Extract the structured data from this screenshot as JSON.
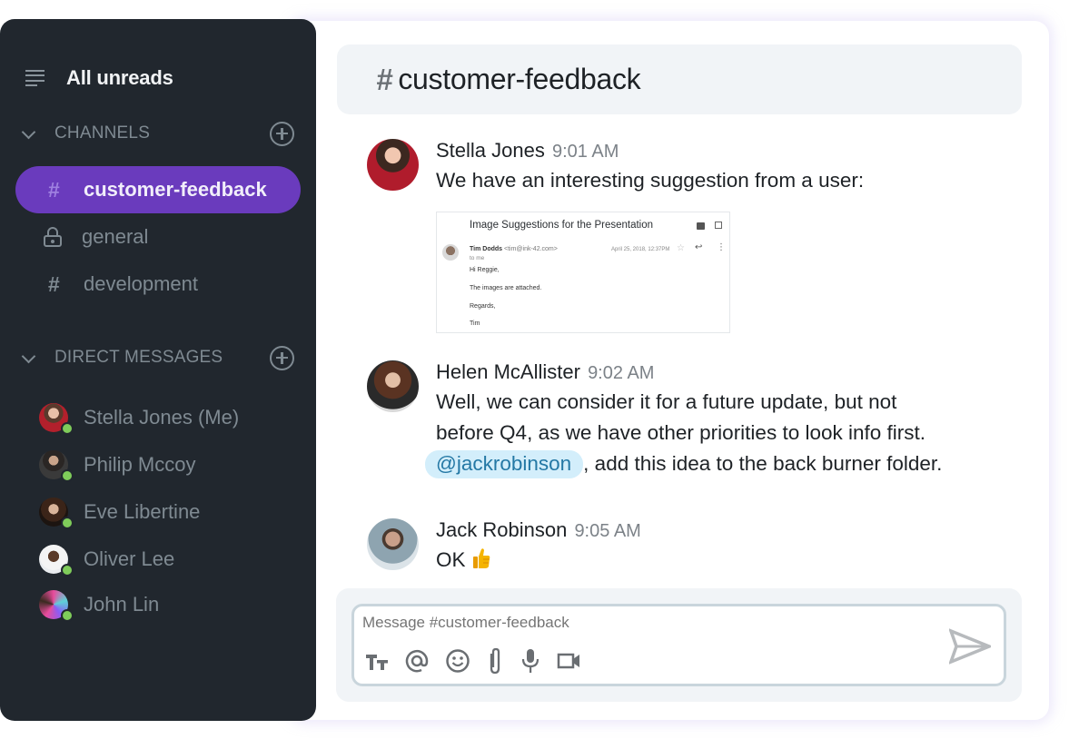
{
  "sidebar": {
    "all_unreads": {
      "label": "All unreads",
      "icon": "list-icon"
    },
    "channels_section": {
      "title": "CHANNELS",
      "add_icon": "add-circle-icon"
    },
    "channels": [
      {
        "name": "customer-feedback",
        "icon": "hash-icon",
        "active": true
      },
      {
        "name": "general",
        "icon": "lock-icon",
        "active": false
      },
      {
        "name": "development",
        "icon": "hash-icon",
        "active": false
      }
    ],
    "dm_section": {
      "title": "DIRECT MESSAGES",
      "add_icon": "add-circle-icon"
    },
    "direct_messages": [
      {
        "name": "Stella Jones (Me)",
        "status": "online"
      },
      {
        "name": "Philip Mccoy",
        "status": "online"
      },
      {
        "name": "Eve Libertine",
        "status": "online"
      },
      {
        "name": "Oliver Lee",
        "status": "online"
      },
      {
        "name": "John Lin",
        "status": "online"
      }
    ]
  },
  "channel_header": {
    "hash": "#",
    "title": "customer-feedback"
  },
  "messages": [
    {
      "author": "Stella Jones",
      "time": "9:01 AM",
      "text": "We have an interesting suggestion from a user:",
      "attachment": {
        "subject": "Image Suggestions for the Presentation",
        "sender_name": "Tim Dodds",
        "sender_email": "<tim@ink-42.com>",
        "to": "to me",
        "date": "April 25, 2018, 12:37PM",
        "body": [
          "Hi Reggie,",
          "The images are attached.",
          "Regards,",
          "Tim"
        ]
      }
    },
    {
      "author": "Helen McAllister",
      "time": "9:02 AM",
      "text_line1": "Well, we can consider it for a future update, but not",
      "text_line2": "before Q4, as we have other priorities to look info first.",
      "mention": "@jackrobinson",
      "text_after_mention": ", add this idea to the back burner folder."
    },
    {
      "author": "Jack Robinson",
      "time": "9:05 AM",
      "text": "OK",
      "emoji": "thumbs-up"
    }
  ],
  "composer": {
    "placeholder": "Message #customer-feedback",
    "value": "",
    "tools": [
      "text-format-icon",
      "mention-icon",
      "emoji-icon",
      "attachment-icon",
      "microphone-icon",
      "video-icon"
    ],
    "send_icon": "send-icon"
  },
  "colors": {
    "sidebar_bg": "#21272e",
    "active_channel": "#6a3bbd",
    "online_status": "#7fcc5a",
    "mention_bg": "#d3eefb",
    "mention_text": "#2478a5"
  }
}
